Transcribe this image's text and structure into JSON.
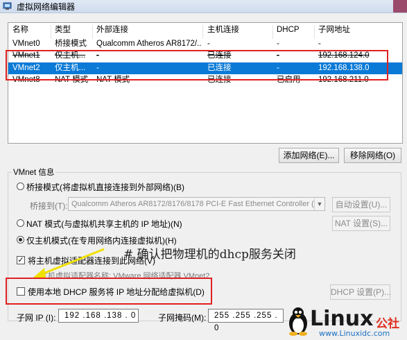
{
  "window": {
    "title": "虚拟网络编辑器"
  },
  "table": {
    "headers": [
      "名称",
      "类型",
      "外部连接",
      "主机连接",
      "DHCP",
      "子网地址"
    ],
    "rows": [
      [
        "VMnet0",
        "桥接模式",
        "Qualcomm Atheros AR8172/...",
        "-",
        "-",
        "-"
      ],
      [
        "VMnet1",
        "仅主机...",
        "-",
        "已连接",
        "-",
        "192.168.124.0"
      ],
      [
        "VMnet2",
        "仅主机...",
        "-",
        "已连接",
        "-",
        "192.168.138.0"
      ],
      [
        "VMnet8",
        "NAT 模式",
        "NAT 模式",
        "已连接",
        "已启用",
        "192.168.211.0"
      ]
    ],
    "selected_row": 2
  },
  "buttons": {
    "add_network": "添加网络(E)...",
    "remove_network": "移除网络(O)"
  },
  "vmnet_info": {
    "label": "VMnet 信息",
    "bridged": "桥接模式(将虚拟机直接连接到外部网络)(B)",
    "bridged_to_label": "桥接到(T):",
    "bridged_to_value": "Qualcomm Atheros AR8172/8176/8178 PCI-E Fast Ethernet Controller (N",
    "auto_settings": "自动设置(U)...",
    "nat": "NAT 模式(与虚拟机共享主机的 IP 地址)(N)",
    "nat_settings": "NAT 设置(S)...",
    "host_only": "仅主机模式(在专用网络内连接虚拟机)(H)",
    "connect_adapter": "将主机虚拟适配器连接到此网络(V)",
    "adapter_name": "主机虚拟适配器名称: VMware 网络适配器 VMnet2",
    "use_dhcp": "使用本地 DHCP 服务将 IP 地址分配给虚拟机(D)",
    "dhcp_settings": "DHCP 设置(P)...",
    "subnet_ip_label": "子网 IP (I):",
    "subnet_ip": "192 .168 .138 . 0",
    "subnet_mask_label": "子网掩码(M):",
    "subnet_mask": "255 .255 .255 . 0"
  },
  "annotation": {
    "text": "# 确认把物理机的dhcp服务关闭"
  },
  "watermark": {
    "brand": "Linux",
    "brand_suffix": "公社",
    "url": "www.Linuxidc.com"
  },
  "colors": {
    "selection": "#0a7ad6",
    "highlight_box": "#e02020",
    "arrow": "#f0e000"
  }
}
